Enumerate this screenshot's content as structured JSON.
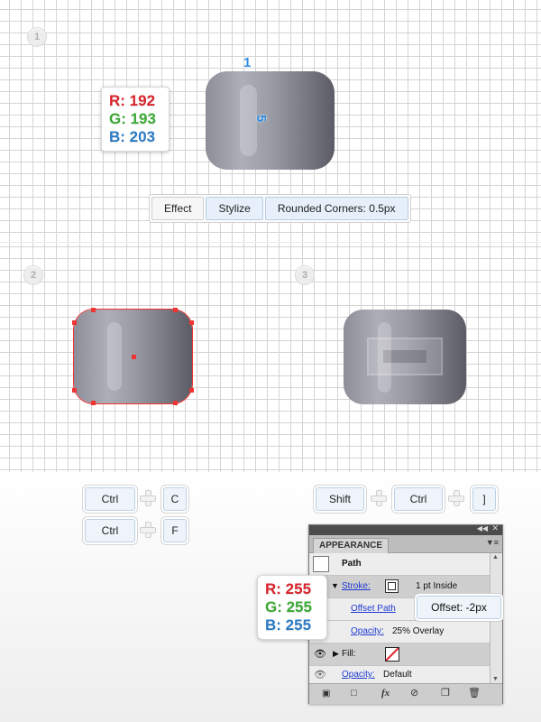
{
  "steps": [
    "1",
    "2",
    "3"
  ],
  "size_labels": {
    "width": "1",
    "height": "5"
  },
  "color_top": {
    "r": "R: 192",
    "g": "G: 193",
    "b": "B: 203"
  },
  "toolbar": {
    "effect": "Effect",
    "stylize": "Stylize",
    "rounded": "Rounded Corners: 0.5px"
  },
  "shortcuts": {
    "copy": [
      "Ctrl",
      "C"
    ],
    "front": [
      "Ctrl",
      "F"
    ],
    "arrange": [
      "Shift",
      "Ctrl",
      "]"
    ]
  },
  "color_white": {
    "r": "R: 255",
    "g": "G: 255",
    "b": "B: 255"
  },
  "appearance": {
    "tab": "APPEARANCE",
    "object": "Path",
    "stroke_label": "Stroke:",
    "stroke_value": "1 pt  Inside",
    "offset_path": "Offset Path",
    "offset_value": "Offset: -2px",
    "opacity_label": "Opacity:",
    "opacity_value": "25% Overlay",
    "fill_label": "Fill:",
    "opacity2_label": "Opacity:",
    "opacity2_value": "Default"
  },
  "icons": [
    "eye-icon",
    "fx-icon",
    "delete-icon",
    "new-item-icon",
    "clear-icon",
    "menu-icon"
  ],
  "colors": {
    "red": "#d8232a",
    "green": "#3aa935",
    "blue": "#2b7bc4",
    "anchor": "#ee3333"
  }
}
